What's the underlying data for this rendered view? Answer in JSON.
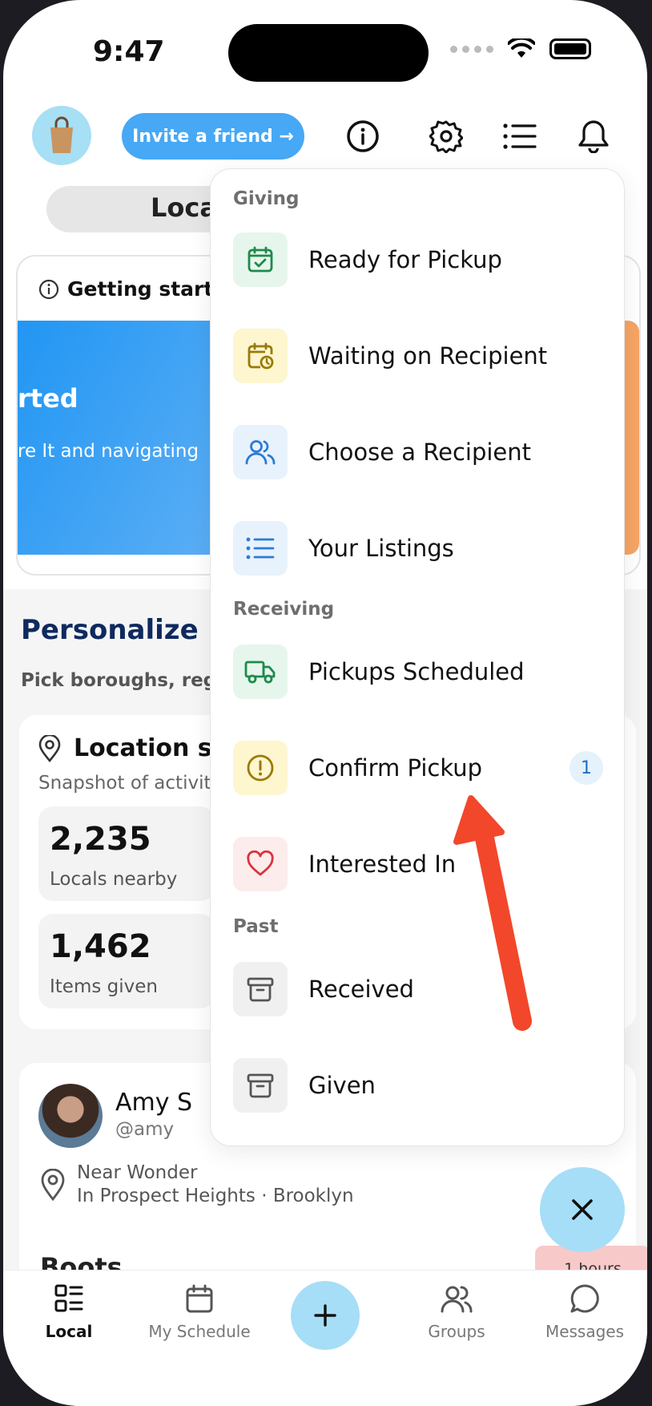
{
  "status_bar": {
    "time": "9:47"
  },
  "header": {
    "invite_label": "Invite a friend →"
  },
  "background": {
    "segment_local": "Loca",
    "getting_started": "Getting starte",
    "banner_heading": "rted",
    "banner_text": "re It and navigating",
    "personalize_title": "Personalize",
    "personalize_sub": "Pick boroughs, regio",
    "location_title": "Location st",
    "location_sub": "Snapshot of activity",
    "stats": [
      {
        "value": "2,235",
        "label": "Locals nearby"
      },
      {
        "value": "1,462",
        "label": "Items given"
      }
    ],
    "profile": {
      "name": "Amy S",
      "handle": "@amy",
      "near_line1": "Near Wonder",
      "near_line2": "In Prospect Heights · Brooklyn"
    },
    "boots_title": "Boots",
    "hours_badge": "1 hours"
  },
  "menu": {
    "sections": [
      {
        "title": "Giving"
      },
      {
        "title": "Receiving"
      },
      {
        "title": "Past"
      }
    ],
    "items": [
      {
        "label": "Ready for Pickup",
        "icon": "calendar-check-icon",
        "bg": "#e6f6ec",
        "color": "#1f8a4c"
      },
      {
        "label": "Waiting on Recipient",
        "icon": "calendar-clock-icon",
        "bg": "#fdf6cf",
        "color": "#9a7a06"
      },
      {
        "label": "Choose a Recipient",
        "icon": "users-icon",
        "bg": "#e8f2fc",
        "color": "#2b7bd6"
      },
      {
        "label": "Your Listings",
        "icon": "list-icon",
        "bg": "#e8f2fc",
        "color": "#2b7bd6"
      },
      {
        "label": "Pickups Scheduled",
        "icon": "truck-icon",
        "bg": "#e6f6ec",
        "color": "#1f8a4c"
      },
      {
        "label": "Confirm Pickup",
        "icon": "alert-circle-icon",
        "bg": "#fdf6cf",
        "color": "#9a7a06",
        "badge": "1"
      },
      {
        "label": "Interested In",
        "icon": "heart-icon",
        "bg": "#fdecec",
        "color": "#d9343c"
      },
      {
        "label": "Received",
        "icon": "archive-icon",
        "bg": "#f0f0f0",
        "color": "#555555"
      },
      {
        "label": "Given",
        "icon": "archive-icon",
        "bg": "#f0f0f0",
        "color": "#555555"
      }
    ]
  },
  "tabbar": {
    "tabs": [
      {
        "label": "Local"
      },
      {
        "label": "My Schedule"
      },
      {
        "label": "Groups"
      },
      {
        "label": "Messages"
      }
    ]
  },
  "colors": {
    "accent": "#47a8f5",
    "fab": "#a6def7",
    "arrow": "#f2472a",
    "title_navy": "#0e2a5e"
  }
}
